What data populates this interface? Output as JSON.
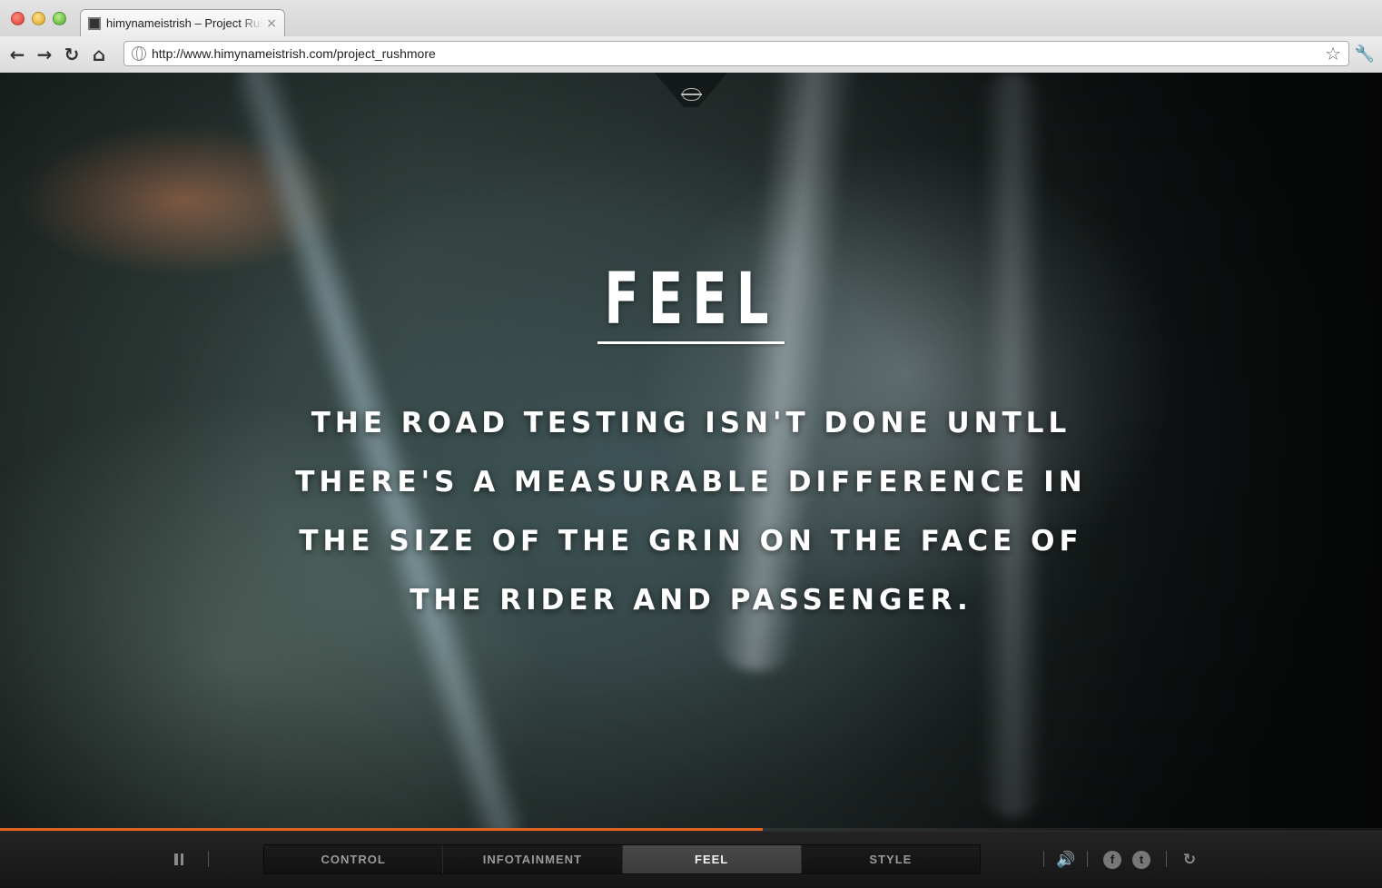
{
  "browser": {
    "tab_title": "himynameistrish – Project Rushmore",
    "tab_close": "×",
    "url": "http://www.himynameistrish.com/project_rushmore",
    "back_glyph": "←",
    "forward_glyph": "→",
    "reload_glyph": "↻",
    "home_glyph": "⌂",
    "star_glyph": "☆",
    "wrench_glyph": "🔧"
  },
  "hero": {
    "title": "FEEL",
    "body": "The road testing isn't done untll there's a measurable difference in the size of the grin on the face of the rider and passenger.",
    "progress_fraction": 0.552
  },
  "controls": {
    "tabs": [
      {
        "label": "CONTROL",
        "active": false
      },
      {
        "label": "INFOTAINMENT",
        "active": false
      },
      {
        "label": "FEEL",
        "active": true
      },
      {
        "label": "STYLE",
        "active": false
      }
    ],
    "volume_glyph": "🔊",
    "facebook_glyph": "f",
    "twitter_glyph": "t",
    "replay_glyph": "↻"
  },
  "colors": {
    "accent": "#e2631f",
    "active_tab": "#444444",
    "bar_background": "#1c1c1c"
  }
}
